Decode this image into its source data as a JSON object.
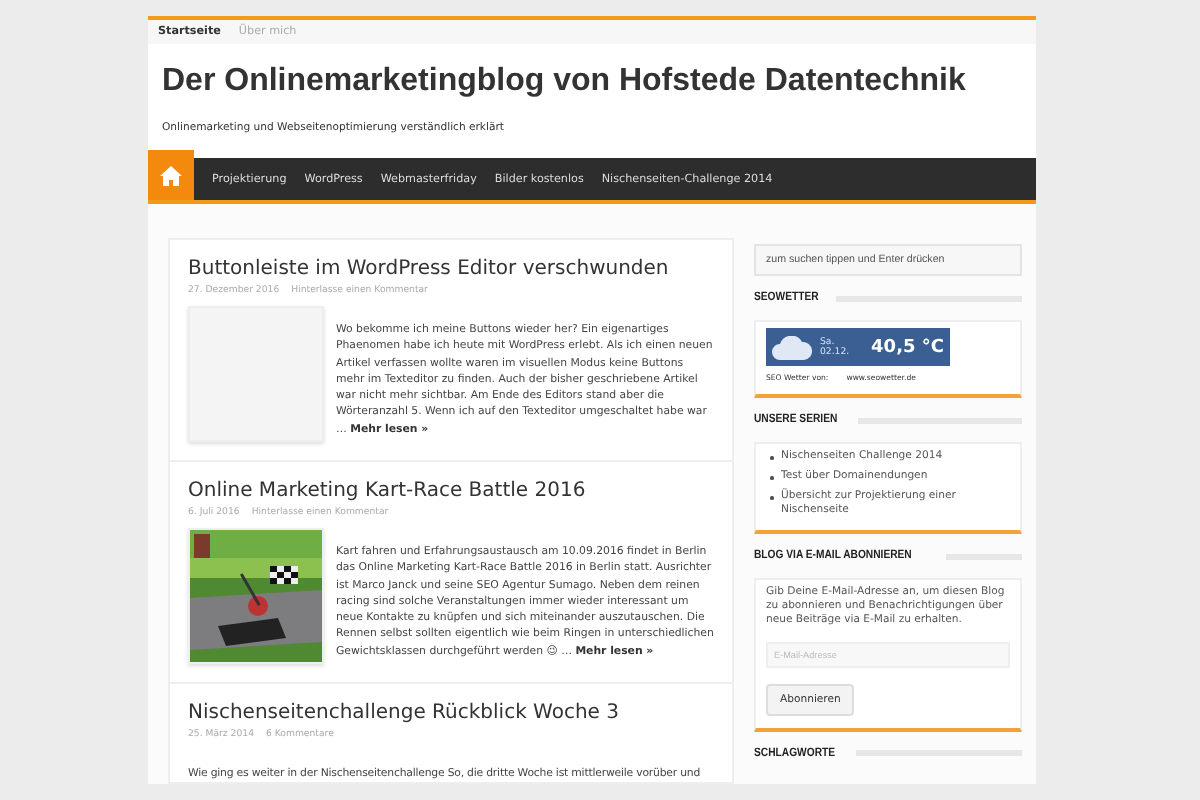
{
  "top_menu": [
    {
      "label": "Startseite",
      "selected": true
    },
    {
      "label": "Über mich",
      "selected": false
    }
  ],
  "site": {
    "title": "Der Onlinemarketingblog von Hofstede Datentechnik",
    "tagline": "Onlinemarketing und Webseitenoptimierung verständlich erklärt"
  },
  "nav": [
    {
      "label": "Projektierung"
    },
    {
      "label": "WordPress"
    },
    {
      "label": "Webmasterfriday"
    },
    {
      "label": "Bilder kostenlos"
    },
    {
      "label": "Nischenseiten-Challenge 2014"
    }
  ],
  "posts": [
    {
      "title": "Buttonleiste im WordPress Editor verschwunden",
      "date": "27. Dezember 2016",
      "comments": "Hinterlasse einen Kommentar",
      "kind": "blank",
      "excerpt": "Wo bekomme ich meine Buttons wieder her? Ein eigenartiges Phaenomen habe ich heute mit WordPress erlebt. Als ich einen neuen Artikel verfassen wollte waren im visuellen Modus keine Buttons mehr im Texteditor zu finden. Auch der bisher geschriebene Artikel war nicht mehr sichtbar. Am Ende des Editors stand aber die Wörteranzahl 5. Wenn ich auf den Texteditor umgeschaltet habe war …",
      "more": "Mehr lesen »"
    },
    {
      "title": "Online Marketing Kart-Race Battle 2016",
      "date": "6. Juli 2016",
      "comments": "Hinterlasse einen Kommentar",
      "kind": "picture",
      "excerpt": "Kart fahren und Erfahrungsaustausch am 10.09.2016 findet in Berlin das Online Marketing Kart-Race Battle 2016 in Berlin statt. Ausrichter ist Marco Janck und seine SEO Agentur Sumago. Neben dem reinen racing sind solche Veranstaltungen immer wieder interessant um neue Kontakte zu knüpfen und sich miteinander auszutauschen. Die Rennen selbst sollten eigentlich wie beim Ringen in unterschiedlichen Gewichtsklassen durchgeführt werden 😉 …",
      "more": "Mehr lesen »"
    },
    {
      "title": "Nischenseitenchallenge Rückblick Woche 3",
      "date": "25. März 2014",
      "comments": "6 Kommentare",
      "kind": "plain",
      "excerpt": "Wie ging es weiter in der Nischenseitenchallenge So, die dritte Woche ist mittlerweile vorüber und"
    }
  ],
  "sidebar": {
    "search": {
      "placeholder": "zum suchen tippen und Enter drücken"
    },
    "weather": {
      "heading": "SEOWETTER",
      "day": "Sa.",
      "date": "02.12.",
      "temperature": "40,5 °C",
      "credit": "SEO Wetter von:",
      "site": "www.seowetter.de"
    },
    "series": {
      "heading": "UNSERE SERIEN",
      "items": [
        "Nischenseiten Challenge 2014",
        "Test über Domainendungen",
        "Übersicht zur Projektierung einer Nischenseite"
      ]
    },
    "subscribe": {
      "heading": "BLOG VIA E-MAIL ABONNIEREN",
      "text": "Gib Deine E-Mail-Adresse an, um diesen Blog zu abonnieren und Benachrichtigungen über neue Beiträge via E-Mail zu erhalten.",
      "placeholder": "E-Mail-Adresse",
      "button": "Abonnieren"
    },
    "tags": {
      "heading": "SCHLAGWORTE"
    }
  }
}
